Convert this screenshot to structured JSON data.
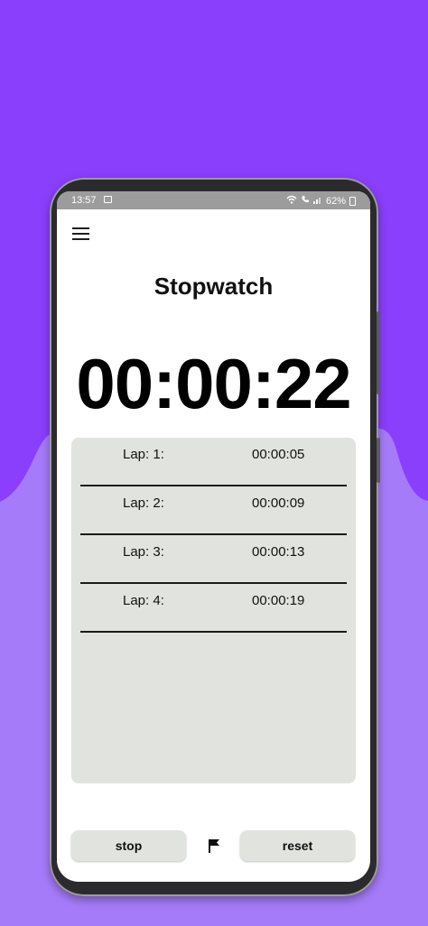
{
  "colors": {
    "background_top": "#8a3ffc",
    "background_bottom": "#a67bfa",
    "laps_panel": "#e1e3de",
    "status_bar": "#9c9c9c"
  },
  "status_bar": {
    "time": "13:57",
    "battery": "62%"
  },
  "app": {
    "title": "Stopwatch",
    "elapsed": "00:00:22"
  },
  "laps": [
    {
      "label": "Lap: 1:",
      "time": "00:00:05"
    },
    {
      "label": "Lap: 2:",
      "time": "00:00:09"
    },
    {
      "label": "Lap: 3:",
      "time": "00:00:13"
    },
    {
      "label": "Lap: 4:",
      "time": "00:00:19"
    }
  ],
  "controls": {
    "stop_label": "stop",
    "reset_label": "reset",
    "lap_icon": "flag-icon",
    "menu_icon": "hamburger-menu-icon"
  }
}
